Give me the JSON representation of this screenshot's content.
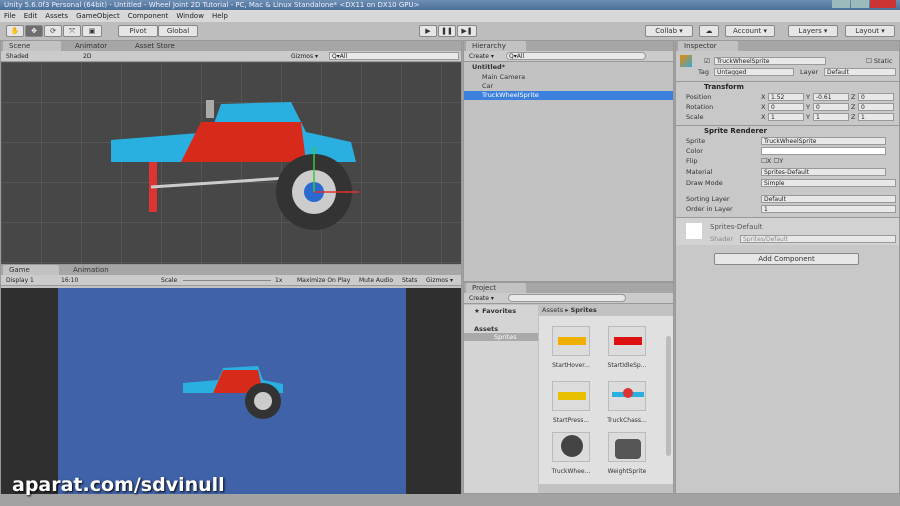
{
  "window": {
    "title": "Unity 5.6.0f3 Personal (64bit) - Untitled - Wheel Joint 2D Tutorial - PC, Mac & Linux Standalone* <DX11 on DX10 GPU>"
  },
  "menu": [
    "File",
    "Edit",
    "Assets",
    "GameObject",
    "Component",
    "Window",
    "Help"
  ],
  "toolbar": {
    "pivot": "Pivot",
    "global": "Global",
    "collab": "Collab ▾",
    "account": "Account ▾",
    "layers": "Layers ▾",
    "layout": "Layout ▾"
  },
  "scene": {
    "tabs": [
      "Scene",
      "Animator",
      "Asset Store"
    ],
    "shading": "Shaded",
    "mode2d": "2D",
    "gizmos": "Gizmos ▾",
    "search": "Q▾All"
  },
  "game": {
    "tabs": [
      "Game",
      "Animation"
    ],
    "display": "Display 1",
    "aspect": "16:10",
    "scale_label": "Scale",
    "scale_value": "1x",
    "maximize": "Maximize On Play",
    "mute": "Mute Audio",
    "stats": "Stats",
    "gizmos": "Gizmos ▾",
    "background": "#3f62a8"
  },
  "hierarchy": {
    "tab": "Hierarchy",
    "create": "Create ▾",
    "search": "Q▾All",
    "scene": "Untitled*",
    "items": [
      "Main Camera",
      "Car",
      "TruckWheelSprite"
    ],
    "selected": "TruckWheelSprite"
  },
  "inspector": {
    "tab": "Inspector",
    "name": "TruckWheelSprite",
    "static": "Static",
    "tag_label": "Tag",
    "tag": "Untagged",
    "layer_label": "Layer",
    "layer": "Default",
    "transform": {
      "title": "Transform",
      "rows": [
        {
          "label": "Position",
          "x": "1.52",
          "y": "-0.61",
          "z": "0"
        },
        {
          "label": "Rotation",
          "x": "0",
          "y": "0",
          "z": "0"
        },
        {
          "label": "Scale",
          "x": "1",
          "y": "1",
          "z": "1"
        }
      ]
    },
    "sprite_renderer": {
      "title": "Sprite Renderer",
      "sprite_label": "Sprite",
      "sprite": "TruckWheelSprite",
      "color_label": "Color",
      "flip_label": "Flip",
      "flip_x": "X",
      "flip_y": "Y",
      "material_label": "Material",
      "material": "Sprites-Default",
      "draw_mode_label": "Draw Mode",
      "draw_mode": "Simple",
      "sorting_layer_label": "Sorting Layer",
      "sorting_layer": "Default",
      "order_label": "Order in Layer",
      "order": "1"
    },
    "material": {
      "name": "Sprites-Default",
      "shader_label": "Shader",
      "shader": "Sprites/Default"
    },
    "add_component": "Add Component"
  },
  "project": {
    "tab": "Project",
    "create": "Create ▾",
    "favorites": "Favorites",
    "assets": "Assets",
    "sprites_folder": "Sprites",
    "breadcrumb": [
      "Assets",
      "Sprites"
    ],
    "items": [
      "StartHover...",
      "StartIdleSp...",
      "StartPress...",
      "TruckChass...",
      "TruckWhee...",
      "WeightSprite"
    ]
  },
  "watermark": "aparat.com/sdvinull"
}
